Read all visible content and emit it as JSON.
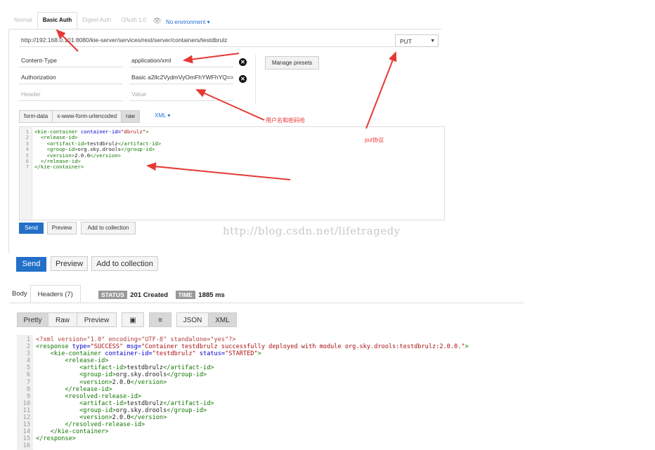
{
  "tabs": [
    "Normal",
    "Basic Auth",
    "Digest Auth",
    "OAuth 1.0"
  ],
  "environment": "No environment",
  "url": "http://192.168.0.101:8080/kie-server/services/rest/server/containers/testdbrulz",
  "method": "PUT",
  "headers": [
    {
      "key": "Content-Type",
      "value": "application/xml"
    },
    {
      "key": "Authorization",
      "value": "Basic a2llc2VydmVyOmFhYWFhYQ=="
    }
  ],
  "header_placeholder": {
    "key": "Header",
    "value": "Value"
  },
  "manage_presets": "Manage presets",
  "body_types": [
    "form-data",
    "x-www-form-urlencoded",
    "raw"
  ],
  "body_format": "XML",
  "request_body": [
    [
      [
        "tg",
        "<kie-container "
      ],
      [
        "at",
        "container-id="
      ],
      [
        "st",
        "\"dbrulz\""
      ],
      [
        "tg",
        ">"
      ]
    ],
    [
      [
        "tg",
        "  <release-id>"
      ]
    ],
    [
      [
        "tg",
        "    <artifact-id>"
      ],
      [
        "tx",
        "testdbrulz"
      ],
      [
        "tg",
        "</artifact-id>"
      ]
    ],
    [
      [
        "tg",
        "    <group-id>"
      ],
      [
        "tx",
        "org.sky.drools"
      ],
      [
        "tg",
        "</group-id>"
      ]
    ],
    [
      [
        "tg",
        "    <version>"
      ],
      [
        "tx",
        "2.0.0"
      ],
      [
        "tg",
        "</version>"
      ]
    ],
    [
      [
        "tg",
        "  </release-id>"
      ]
    ],
    [
      [
        "tg",
        "</kie-container>"
      ]
    ]
  ],
  "inner_actions": [
    "Send",
    "Preview",
    "Add to collection"
  ],
  "watermark": "http://blog.csdn.net/lifetragedy",
  "outer_actions": [
    "Send",
    "Preview",
    "Add to collection"
  ],
  "response_tabs": {
    "body": "Body",
    "headers": "Headers (7)"
  },
  "status": {
    "label": "STATUS",
    "value": "201 Created",
    "time_label": "TIME",
    "time_value": "1885 ms"
  },
  "view_buttons": [
    "Pretty",
    "Raw",
    "Preview",
    "JSON",
    "XML"
  ],
  "response_body": [
    [
      [
        "pi",
        "<?xml version=\"1.0\" encoding=\"UTF-8\" standalone=\"yes\"?>"
      ]
    ],
    [
      [
        "tg",
        "<response "
      ],
      [
        "at",
        "type="
      ],
      [
        "st",
        "\"SUCCESS\" "
      ],
      [
        "at",
        "msg="
      ],
      [
        "st",
        "\"Container testdbrulz successfully deployed with module org.sky.drools:testdbrulz:2.0.0.\""
      ],
      [
        "tg",
        ">"
      ]
    ],
    [
      [
        "tg",
        "    <kie-container "
      ],
      [
        "at",
        "container-id="
      ],
      [
        "st",
        "\"testdbrulz\" "
      ],
      [
        "at",
        "status="
      ],
      [
        "st",
        "\"STARTED\""
      ],
      [
        "tg",
        ">"
      ]
    ],
    [
      [
        "tg",
        "        <release-id>"
      ]
    ],
    [
      [
        "tg",
        "            <artifact-id>"
      ],
      [
        "tx",
        "testdbrulz"
      ],
      [
        "tg",
        "</artifact-id>"
      ]
    ],
    [
      [
        "tg",
        "            <group-id>"
      ],
      [
        "tx",
        "org.sky.drools"
      ],
      [
        "tg",
        "</group-id>"
      ]
    ],
    [
      [
        "tg",
        "            <version>"
      ],
      [
        "tx",
        "2.0.0"
      ],
      [
        "tg",
        "</version>"
      ]
    ],
    [
      [
        "tg",
        "        </release-id>"
      ]
    ],
    [
      [
        "tg",
        "        <resolved-release-id>"
      ]
    ],
    [
      [
        "tg",
        "            <artifact-id>"
      ],
      [
        "tx",
        "testdbrulz"
      ],
      [
        "tg",
        "</artifact-id>"
      ]
    ],
    [
      [
        "tg",
        "            <group-id>"
      ],
      [
        "tx",
        "org.sky.drools"
      ],
      [
        "tg",
        "</group-id>"
      ]
    ],
    [
      [
        "tg",
        "            <version>"
      ],
      [
        "tx",
        "2.0.0"
      ],
      [
        "tg",
        "</version>"
      ]
    ],
    [
      [
        "tg",
        "        </resolved-release-id>"
      ]
    ],
    [
      [
        "tg",
        "    </kie-container>"
      ]
    ],
    [
      [
        "tg",
        "</response>"
      ]
    ],
    []
  ],
  "annotations": {
    "auth_note": "用户名和密码哈",
    "put_note": "put协议"
  },
  "colors": {
    "accent": "#2370c9",
    "arrow": "#e53935",
    "badge": "#999999"
  }
}
